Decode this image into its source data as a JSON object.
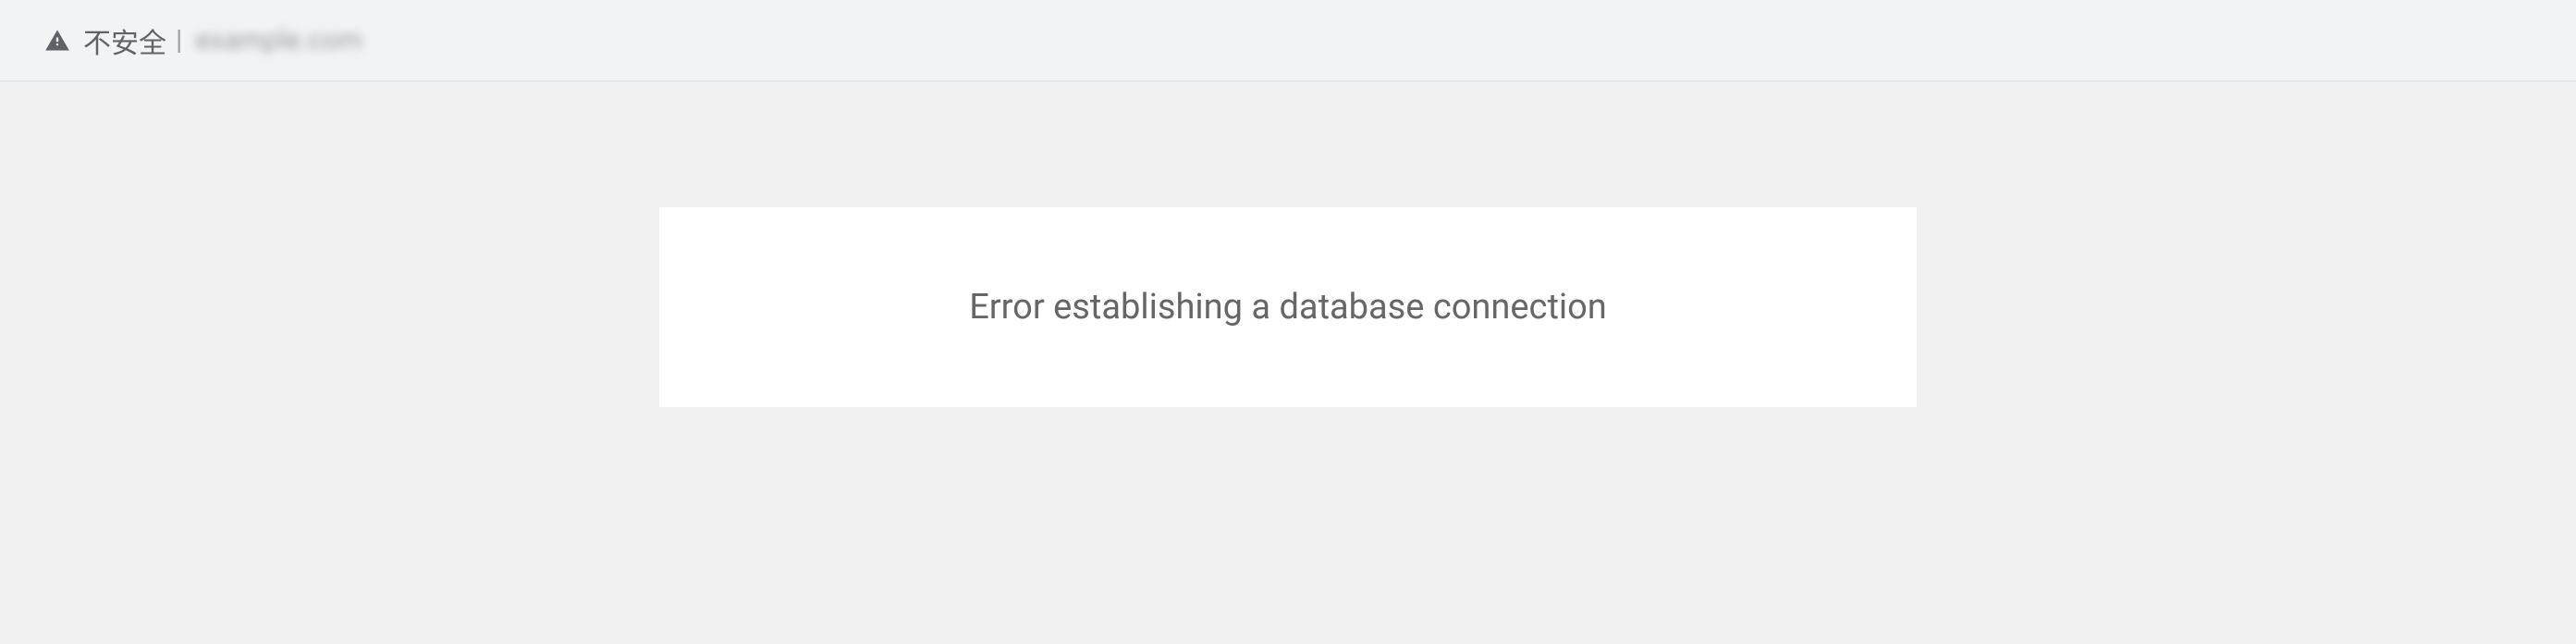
{
  "address_bar": {
    "security_label": "不安全",
    "separator": "|",
    "url_blurred": "example.com"
  },
  "page": {
    "error_message": "Error establishing a database connection"
  }
}
